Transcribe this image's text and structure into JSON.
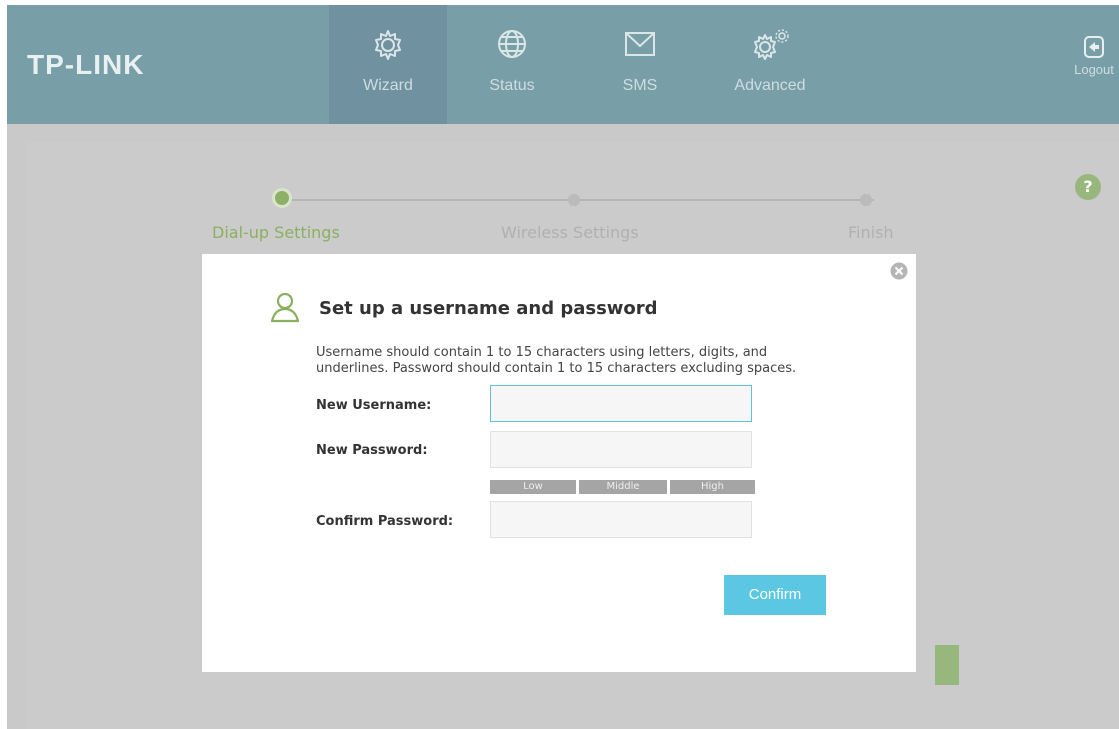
{
  "brand": "TP-LINK",
  "nav": [
    {
      "label": "Wizard",
      "icon": "gear-icon",
      "active": true
    },
    {
      "label": "Status",
      "icon": "globe-icon",
      "active": false
    },
    {
      "label": "SMS",
      "icon": "envelope-icon",
      "active": false
    },
    {
      "label": "Advanced",
      "icon": "gears-icon",
      "active": false
    }
  ],
  "logout": "Logout",
  "steps": [
    {
      "label": "Dial-up Settings",
      "active": true
    },
    {
      "label": "Wireless Settings",
      "active": false
    },
    {
      "label": "Finish",
      "active": false
    }
  ],
  "help": "?",
  "modal": {
    "title": "Set up a username and password",
    "description": "Username should contain 1 to 15 characters using letters, digits, and underlines. Password should contain 1 to 15 characters excluding spaces.",
    "username_label": "New Username:",
    "username_value": "",
    "password_label": "New Password:",
    "password_value": "",
    "strength": [
      "Low",
      "Middle",
      "High"
    ],
    "confirm_label": "Confirm Password:",
    "confirm_value": "",
    "confirm_button": "Confirm"
  },
  "colors": {
    "nav_bg": "#789ea7",
    "accent_green": "#8ab05f",
    "confirm_blue": "#5bc7e3"
  }
}
